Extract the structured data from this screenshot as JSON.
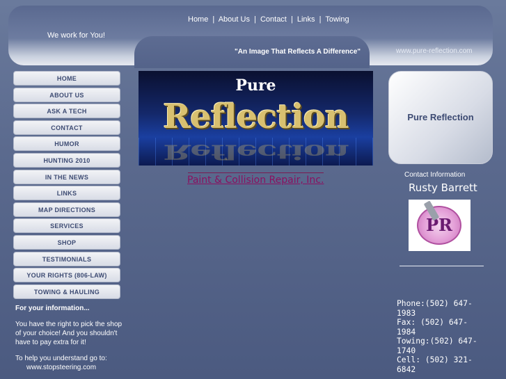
{
  "header": {
    "nav": [
      "Home",
      "About Us",
      "Contact",
      "Links",
      "Towing"
    ],
    "nav_separator": "|",
    "tagline": "We work for You!",
    "motto": "\"An Image That Reflects A Difference\"",
    "url": "www.pure-reflection.com"
  },
  "sidenav": {
    "items": [
      "HOME",
      "ABOUT US",
      "ASK A TECH",
      "CONTACT",
      "HUMOR",
      "HUNTING 2010",
      "IN THE NEWS",
      "LINKS",
      "MAP DIRECTIONS",
      "SERVICES",
      "SHOP",
      "TESTIMONIALS",
      "YOUR RIGHTS (806-LAW)",
      "TOWING & HAULING"
    ]
  },
  "info": {
    "heading": "For your information...",
    "para1": "You have the right to pick the shop of your choice! And you shouldn't have to pay extra for it!",
    "para2": "To help you understand go to:",
    "link": "www.stopsteering.com"
  },
  "banner": {
    "line1": "Pure",
    "line2": "Reflection"
  },
  "company_link": "Paint & Collision Repair, Inc.",
  "card": {
    "title": "Pure Reflection"
  },
  "contact": {
    "heading": "Contact Information",
    "name": "Rusty Barrett",
    "logo_text": "PR",
    "phone": "Phone:(502) 647-1983",
    "fax": "Fax: (502) 647-1984",
    "towing": "Towing:(502) 647-1740",
    "cell": "Cell: (502) 321-6842"
  }
}
